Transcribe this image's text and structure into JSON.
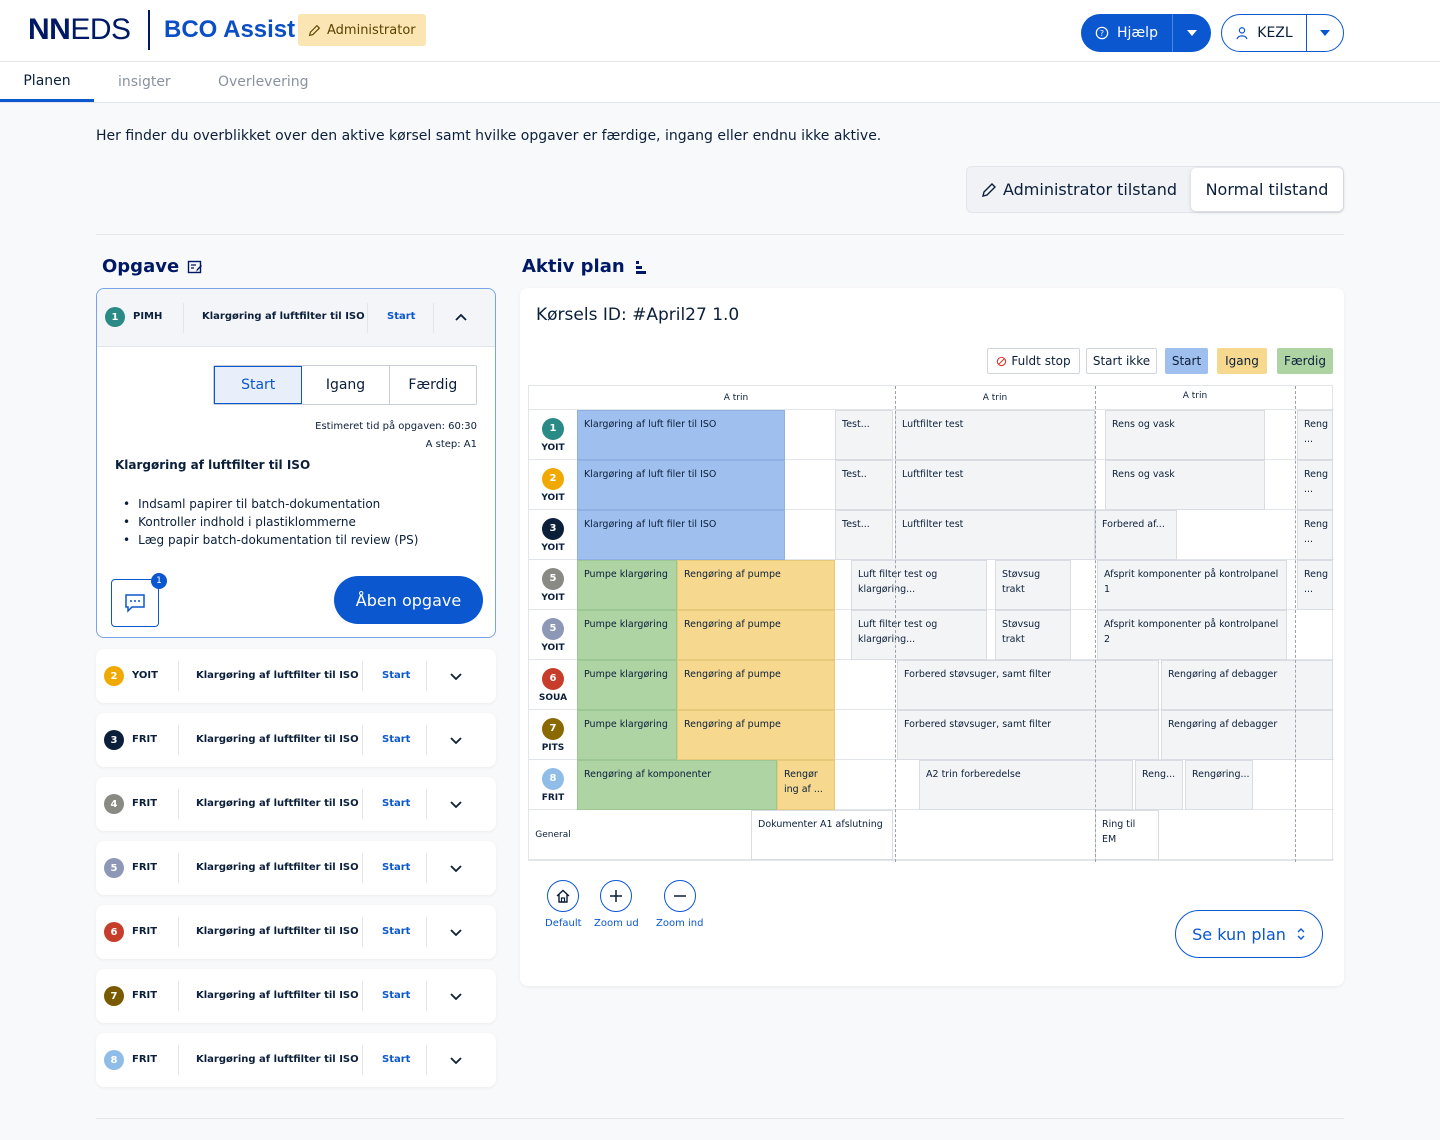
{
  "header": {
    "logo_bold": "NN",
    "logo_light": "EDS",
    "app_name": "BCO Assist",
    "admin_badge": "Administrator",
    "help_label": "Hjælp",
    "user_label": "KEZL"
  },
  "tabs": [
    {
      "label": "Planen",
      "active": true
    },
    {
      "label": "insigter",
      "active": false
    },
    {
      "label": "Overlevering",
      "active": false
    }
  ],
  "intro": "Her finder du overblikket over den aktive kørsel samt hvilke opgaver er færdige, ingang eller endnu ikke aktive.",
  "mode": {
    "admin": "Administrator tilstand",
    "normal": "Normal tilstand"
  },
  "tasks_panel": {
    "title": "Opgave",
    "expanded": {
      "num": "1",
      "code": "PIMH",
      "title": "Klargøring af luftfilter til ISO",
      "status": "Start",
      "segments": [
        "Start",
        "Igang",
        "Færdig"
      ],
      "estimate": "Estimeret tid på opgaven: 60:30",
      "step": "A step: A1",
      "desc_title": "Klargøring af luftfilter til ISO",
      "bullets": [
        "Indsaml papirer til batch-dokumentation",
        "Kontroller indhold i plastiklommerne",
        "Læg papir batch-dokumentation til review (PS)"
      ],
      "comment_count": "1",
      "open_label": "Åben opgave"
    },
    "rows": [
      {
        "num": "2",
        "code": "YOIT",
        "title": "Klargøring af luftfilter til ISO",
        "status": "Start",
        "color": "#f0a900"
      },
      {
        "num": "3",
        "code": "FRIT",
        "title": "Klargøring af luftfilter til ISO",
        "status": "Start",
        "color": "#0b1f3a"
      },
      {
        "num": "4",
        "code": "FRIT",
        "title": "Klargøring af luftfilter til ISO",
        "status": "Start",
        "color": "#8a8a84"
      },
      {
        "num": "5",
        "code": "FRIT",
        "title": "Klargøring af luftfilter til ISO",
        "status": "Start",
        "color": "#8d98b6"
      },
      {
        "num": "6",
        "code": "FRIT",
        "title": "Klargøring af luftfilter til ISO",
        "status": "Start",
        "color": "#c63e2b"
      },
      {
        "num": "7",
        "code": "FRIT",
        "title": "Klargøring af luftfilter til ISO",
        "status": "Start",
        "color": "#7a5a00"
      },
      {
        "num": "8",
        "code": "FRIT",
        "title": "Klargøring af luftfilter til ISO",
        "status": "Start",
        "color": "#8fbde8"
      }
    ]
  },
  "plan": {
    "title": "Aktiv plan",
    "run_id": "Kørsels ID: #April27 1.0",
    "legend": {
      "full_stop": "Fuldt stop",
      "not_started": "Start ikke",
      "start": "Start",
      "ongoing": "Igang",
      "done": "Færdig"
    },
    "headers": [
      "A trin",
      "A trin",
      "A trin"
    ],
    "lanes": [
      {
        "num": "1",
        "code": "YOIT",
        "color": "#2a8a86"
      },
      {
        "num": "2",
        "code": "YOIT",
        "color": "#f0a900"
      },
      {
        "num": "3",
        "code": "YOIT",
        "color": "#0b1f3a"
      },
      {
        "num": "5",
        "code": "YOIT",
        "color": "#8a8a84"
      },
      {
        "num": "5",
        "code": "YOIT",
        "color": "#8d98b6"
      },
      {
        "num": "6",
        "code": "SOUA",
        "color": "#c63e2b"
      },
      {
        "num": "7",
        "code": "PITS",
        "color": "#8a6a00"
      },
      {
        "num": "8",
        "code": "FRIT",
        "color": "#8fbde8"
      }
    ],
    "general_label": "General",
    "bars": {
      "r1": [
        "Klargøring af luft filer til ISO",
        "Test...",
        "Luftfilter test",
        "Rens og vask",
        "Reng ..."
      ],
      "r2": [
        "Klargøring af luft filer til ISO",
        "Test..",
        "Luftfilter test",
        "Rens og vask",
        "Reng ..."
      ],
      "r3": [
        "Klargøring af luft filer til ISO",
        "Test...",
        "Luftfilter test",
        "Forbered af...",
        "Reng ..."
      ],
      "r4": [
        "Pumpe klargøring",
        "Rengøring af pumpe",
        "Luft filter test og klargøring...",
        "Støvsug trakt",
        "Afsprit komponenter på kontrolpanel 1",
        "Reng ..."
      ],
      "r5": [
        "Pumpe klargøring",
        "Rengøring af pumpe",
        "Luft filter test og klargøring...",
        "Støvsug trakt",
        "Afsprit komponenter på kontrolpanel 2"
      ],
      "r6": [
        "Pumpe klargøring",
        "Rengøring af pumpe",
        "Forbered støvsuger, samt filter",
        "Rengøring af debagger"
      ],
      "r7": [
        "Pumpe klargøring",
        "Rengøring af pumpe",
        "Forbered støvsuger, samt filter",
        "Rengøring af debagger"
      ],
      "r8": [
        "Rengøring af komponenter",
        "Rengør ing af ...",
        "A2 trin forberedelse",
        "Reng...",
        "Rengøring..."
      ],
      "general": [
        "Dokumenter A1 afslutning",
        "Ring til EM"
      ]
    },
    "zoom": {
      "default": "Default",
      "zoom_out": "Zoom ud",
      "zoom_in": "Zoom ind"
    },
    "see_plan": "Se kun plan"
  },
  "colors": {
    "primary": "#0b57d0",
    "navy": "#001965",
    "start_blue": "#9fbfee",
    "ongoing_yellow": "#f6d98e",
    "done_green": "#aed4a4"
  }
}
